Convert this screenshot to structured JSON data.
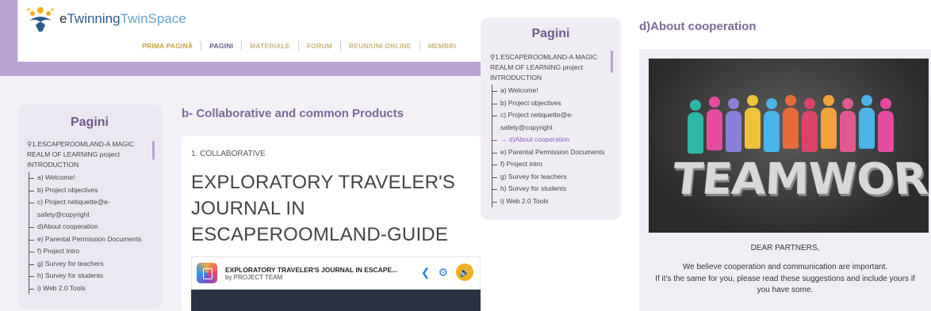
{
  "left": {
    "logo": {
      "prefix": "e",
      "twinning": "Twinning",
      "space": "TwinSpace"
    },
    "nav": [
      "PRIMA PAGINĂ",
      "PAGINI",
      "MATERIALE",
      "FORUM",
      "REUNIUNI ONLINE",
      "MEMBRI"
    ],
    "sidebar": {
      "title": "Pagini",
      "root": "1.ESCAPEROOMLAND-A MAGIC REALM OF LEARNING project INTRODUCTION",
      "items": [
        "a) Welcome!",
        "b) Project objectives",
        "c) Project netiquette@e-safety@copyright",
        "d)About cooperation",
        "e) Parental Permission Documents",
        "f) Project intro",
        "g) Survey for teachers",
        "h) Survey for students",
        "i) Web 2.0 Tools"
      ]
    },
    "page_title": "b- Collaborative and common Products",
    "card": {
      "kicker": "1. COLLABORATIVE",
      "heading": "EXPLORATORY TRAVELER'S JOURNAL IN ESCAPEROOMLAND-GUIDE",
      "embed_title": "EXPLORATORY TRAVELER'S JOURNAL IN ESCAPE...",
      "embed_author": "by PROJECT TEAM"
    }
  },
  "right": {
    "sidebar": {
      "title": "Pagini",
      "root": "1.ESCAPEROOMLAND-A MAGIC REALM OF LEARNING project INTRODUCTION",
      "items": [
        "a) Welcome!",
        "b) Project objectives",
        "c) Project netiquette@e-safety@copyright",
        "d)About cooperation",
        "e) Parental Permission Documents",
        "f) Project intro",
        "g) Survey for teachers",
        "h) Survey for students",
        "i) Web 2.0 Tools"
      ],
      "active_marker": "→"
    },
    "page_title": "d)About cooperation",
    "image_word": "TEAMWORK",
    "greeting": "DEAR PARTNERS,",
    "body1": "We believe cooperation and communication are important.",
    "body2": "If it's the same for you, please read these suggestions and include yours if you have some."
  },
  "colors": {
    "accent": "#7a6a9a",
    "band": "#b9a2d4",
    "nav": "#c7a43a"
  },
  "icons": {
    "search": "search-icon",
    "share": "share-icon",
    "settings": "gear-icon",
    "sound": "sound-icon",
    "app": "journal-app-icon"
  }
}
